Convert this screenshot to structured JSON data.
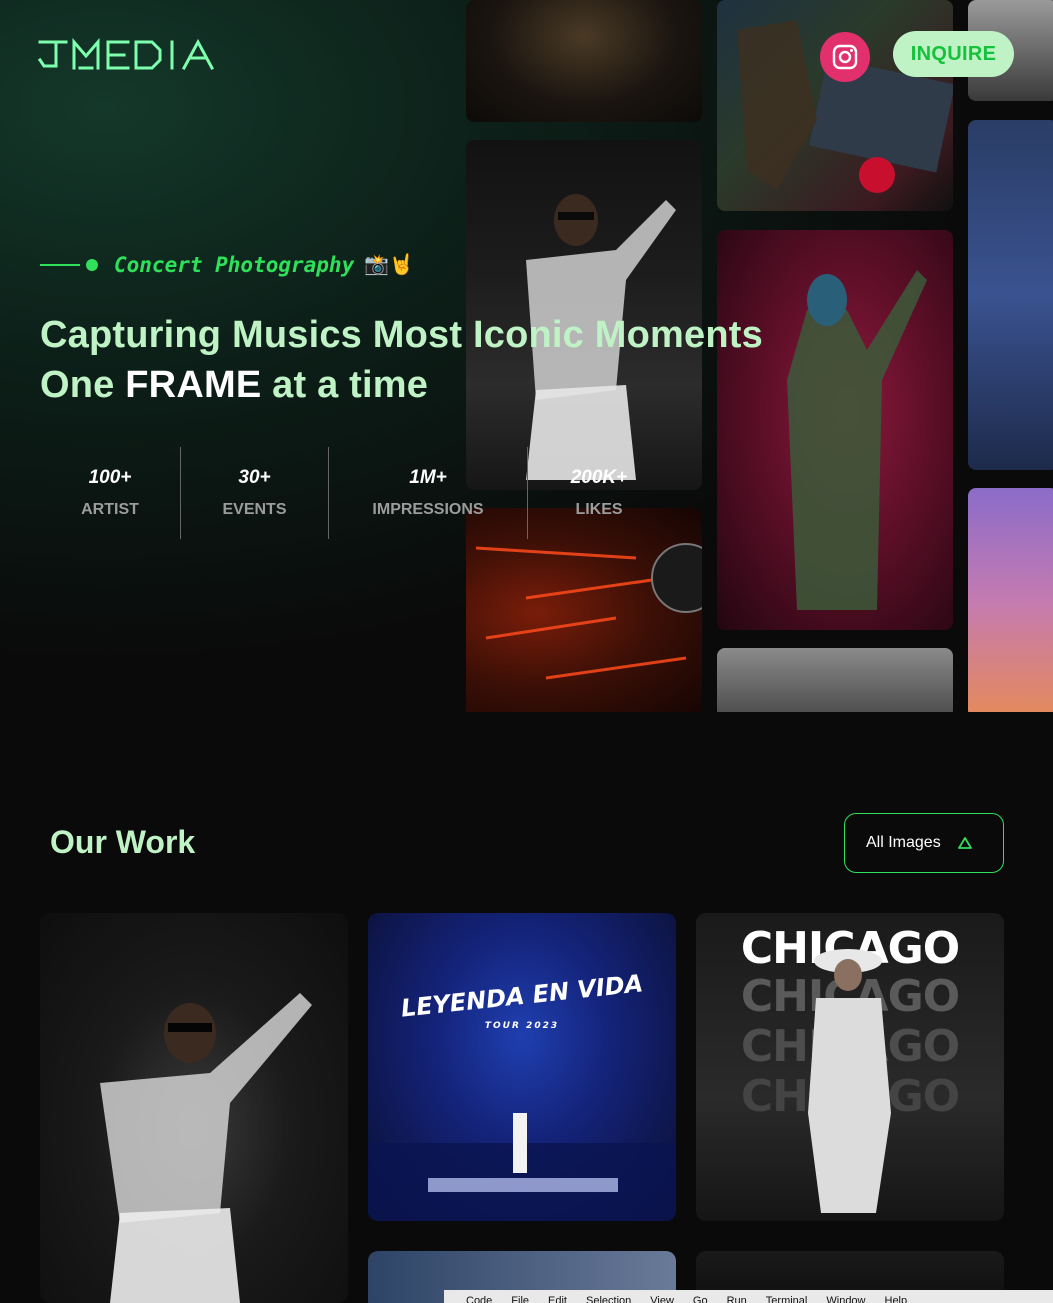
{
  "brand": {
    "logo_text": "JMEDIA"
  },
  "header": {
    "inquire_label": "INQUIRE",
    "instagram_icon": "instagram-icon"
  },
  "colors": {
    "mint": "#bff2c4",
    "accent_green": "#2fe05a",
    "instagram_pink": "#e1306c"
  },
  "hero": {
    "tagline": "Concert Photography",
    "tagline_emoji": "📸🤘",
    "headline_line1": "Capturing Musics Most Iconic Moments",
    "headline_line2_a": "One ",
    "headline_line2_b": "FRAME",
    "headline_line2_c": " at a time",
    "stats": [
      {
        "value": "100+",
        "label": "ARTIST"
      },
      {
        "value": "30+",
        "label": "EVENTS"
      },
      {
        "value": "1M+",
        "label": "IMPRESSIONS"
      },
      {
        "value": "200K+",
        "label": "LIKES"
      }
    ]
  },
  "work": {
    "title": "Our Work",
    "filter_label": "All Images",
    "filter_icon": "chevron-icon",
    "cards": [
      {
        "overlay": ""
      },
      {
        "overlay_big": "LEYENDA EN VIDA",
        "overlay_small": "TOUR 2023"
      },
      {
        "overlay_lines": [
          "CHICAGO",
          "CHICAGO",
          "CHICAGO",
          "CHICAGO"
        ]
      }
    ]
  },
  "menubar": {
    "items": [
      "Code",
      "File",
      "Edit",
      "Selection",
      "View",
      "Go",
      "Run",
      "Terminal",
      "Window",
      "Help"
    ]
  }
}
